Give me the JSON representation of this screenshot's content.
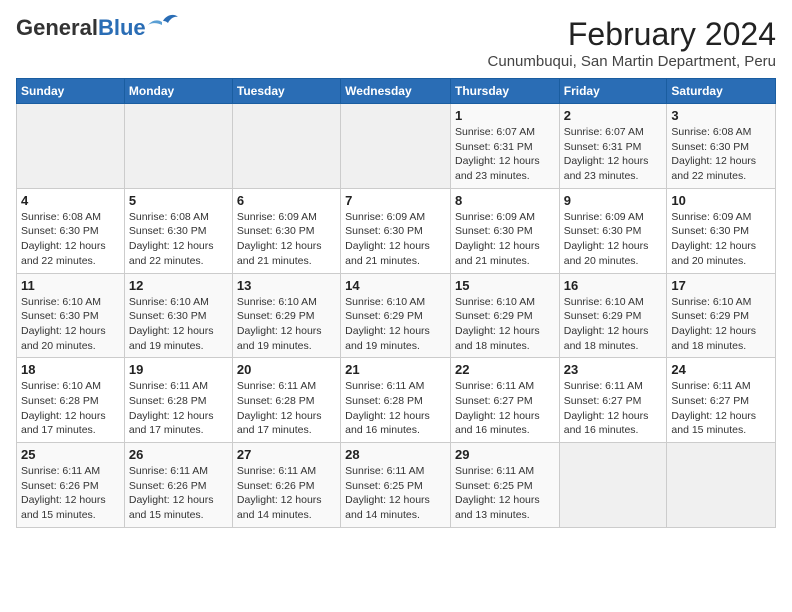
{
  "header": {
    "logo_general": "General",
    "logo_blue": "Blue",
    "title": "February 2024",
    "subtitle": "Cunumbuqui, San Martin Department, Peru"
  },
  "days_of_week": [
    "Sunday",
    "Monday",
    "Tuesday",
    "Wednesday",
    "Thursday",
    "Friday",
    "Saturday"
  ],
  "weeks": [
    [
      {
        "day": "",
        "info": ""
      },
      {
        "day": "",
        "info": ""
      },
      {
        "day": "",
        "info": ""
      },
      {
        "day": "",
        "info": ""
      },
      {
        "day": "1",
        "info": "Sunrise: 6:07 AM\nSunset: 6:31 PM\nDaylight: 12 hours\nand 23 minutes."
      },
      {
        "day": "2",
        "info": "Sunrise: 6:07 AM\nSunset: 6:31 PM\nDaylight: 12 hours\nand 23 minutes."
      },
      {
        "day": "3",
        "info": "Sunrise: 6:08 AM\nSunset: 6:30 PM\nDaylight: 12 hours\nand 22 minutes."
      }
    ],
    [
      {
        "day": "4",
        "info": "Sunrise: 6:08 AM\nSunset: 6:30 PM\nDaylight: 12 hours\nand 22 minutes."
      },
      {
        "day": "5",
        "info": "Sunrise: 6:08 AM\nSunset: 6:30 PM\nDaylight: 12 hours\nand 22 minutes."
      },
      {
        "day": "6",
        "info": "Sunrise: 6:09 AM\nSunset: 6:30 PM\nDaylight: 12 hours\nand 21 minutes."
      },
      {
        "day": "7",
        "info": "Sunrise: 6:09 AM\nSunset: 6:30 PM\nDaylight: 12 hours\nand 21 minutes."
      },
      {
        "day": "8",
        "info": "Sunrise: 6:09 AM\nSunset: 6:30 PM\nDaylight: 12 hours\nand 21 minutes."
      },
      {
        "day": "9",
        "info": "Sunrise: 6:09 AM\nSunset: 6:30 PM\nDaylight: 12 hours\nand 20 minutes."
      },
      {
        "day": "10",
        "info": "Sunrise: 6:09 AM\nSunset: 6:30 PM\nDaylight: 12 hours\nand 20 minutes."
      }
    ],
    [
      {
        "day": "11",
        "info": "Sunrise: 6:10 AM\nSunset: 6:30 PM\nDaylight: 12 hours\nand 20 minutes."
      },
      {
        "day": "12",
        "info": "Sunrise: 6:10 AM\nSunset: 6:30 PM\nDaylight: 12 hours\nand 19 minutes."
      },
      {
        "day": "13",
        "info": "Sunrise: 6:10 AM\nSunset: 6:29 PM\nDaylight: 12 hours\nand 19 minutes."
      },
      {
        "day": "14",
        "info": "Sunrise: 6:10 AM\nSunset: 6:29 PM\nDaylight: 12 hours\nand 19 minutes."
      },
      {
        "day": "15",
        "info": "Sunrise: 6:10 AM\nSunset: 6:29 PM\nDaylight: 12 hours\nand 18 minutes."
      },
      {
        "day": "16",
        "info": "Sunrise: 6:10 AM\nSunset: 6:29 PM\nDaylight: 12 hours\nand 18 minutes."
      },
      {
        "day": "17",
        "info": "Sunrise: 6:10 AM\nSunset: 6:29 PM\nDaylight: 12 hours\nand 18 minutes."
      }
    ],
    [
      {
        "day": "18",
        "info": "Sunrise: 6:10 AM\nSunset: 6:28 PM\nDaylight: 12 hours\nand 17 minutes."
      },
      {
        "day": "19",
        "info": "Sunrise: 6:11 AM\nSunset: 6:28 PM\nDaylight: 12 hours\nand 17 minutes."
      },
      {
        "day": "20",
        "info": "Sunrise: 6:11 AM\nSunset: 6:28 PM\nDaylight: 12 hours\nand 17 minutes."
      },
      {
        "day": "21",
        "info": "Sunrise: 6:11 AM\nSunset: 6:28 PM\nDaylight: 12 hours\nand 16 minutes."
      },
      {
        "day": "22",
        "info": "Sunrise: 6:11 AM\nSunset: 6:27 PM\nDaylight: 12 hours\nand 16 minutes."
      },
      {
        "day": "23",
        "info": "Sunrise: 6:11 AM\nSunset: 6:27 PM\nDaylight: 12 hours\nand 16 minutes."
      },
      {
        "day": "24",
        "info": "Sunrise: 6:11 AM\nSunset: 6:27 PM\nDaylight: 12 hours\nand 15 minutes."
      }
    ],
    [
      {
        "day": "25",
        "info": "Sunrise: 6:11 AM\nSunset: 6:26 PM\nDaylight: 12 hours\nand 15 minutes."
      },
      {
        "day": "26",
        "info": "Sunrise: 6:11 AM\nSunset: 6:26 PM\nDaylight: 12 hours\nand 15 minutes."
      },
      {
        "day": "27",
        "info": "Sunrise: 6:11 AM\nSunset: 6:26 PM\nDaylight: 12 hours\nand 14 minutes."
      },
      {
        "day": "28",
        "info": "Sunrise: 6:11 AM\nSunset: 6:25 PM\nDaylight: 12 hours\nand 14 minutes."
      },
      {
        "day": "29",
        "info": "Sunrise: 6:11 AM\nSunset: 6:25 PM\nDaylight: 12 hours\nand 13 minutes."
      },
      {
        "day": "",
        "info": ""
      },
      {
        "day": "",
        "info": ""
      }
    ]
  ]
}
